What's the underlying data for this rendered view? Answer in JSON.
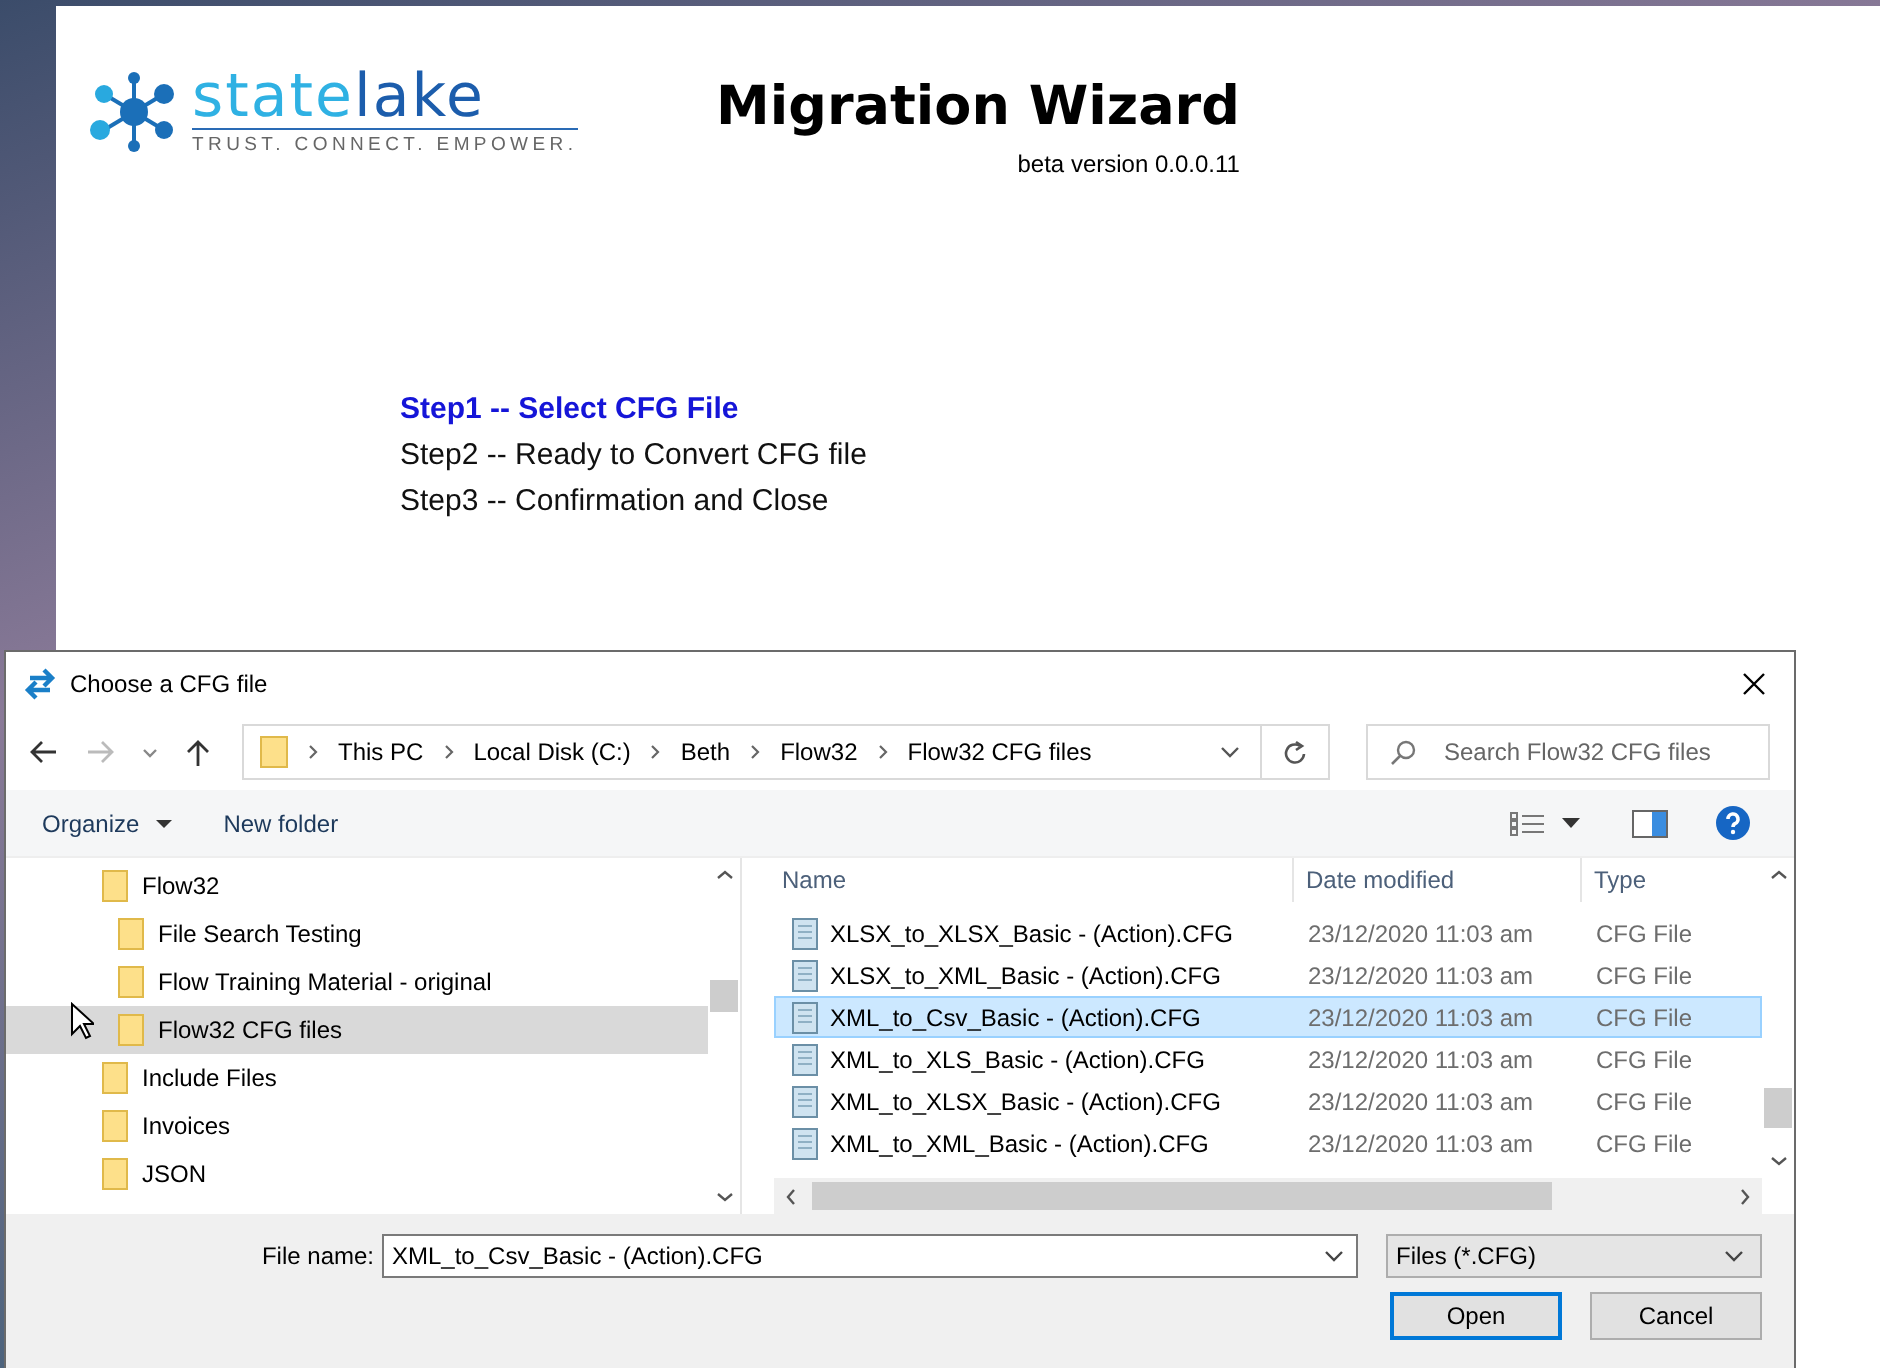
{
  "app": {
    "logo": {
      "part_1": "state",
      "part_2": "lake",
      "tagline": "TRUST. CONNECT. EMPOWER."
    },
    "title": "Migration Wizard",
    "version": "beta version 0.0.0.11",
    "steps": [
      {
        "label": "Step1 -- Select CFG File",
        "selected": true
      },
      {
        "label": "Step2 -- Ready to Convert CFG file",
        "selected": false
      },
      {
        "label": "Step3 -- Confirmation and Close",
        "selected": false
      }
    ]
  },
  "dialog": {
    "title": "Choose a CFG file",
    "breadcrumbs": [
      "This PC",
      "Local Disk (C:)",
      "Beth",
      "Flow32",
      "Flow32 CFG files"
    ],
    "search": {
      "placeholder": "Search Flow32 CFG files"
    },
    "toolbar": {
      "organize": "Organize",
      "new_folder": "New folder"
    },
    "tree": [
      {
        "label": "Flow32",
        "selected": false,
        "children": [
          {
            "label": "File Search Testing",
            "selected": false
          },
          {
            "label": "Flow Training Material - original",
            "selected": false
          },
          {
            "label": "Flow32 CFG files",
            "selected": true
          }
        ]
      },
      {
        "label": "Include Files",
        "selected": false
      },
      {
        "label": "Invoices",
        "selected": false
      },
      {
        "label": "JSON",
        "selected": false
      }
    ],
    "columns": [
      "Name",
      "Date modified",
      "Type"
    ],
    "rows": [
      {
        "name": "XLSX_to_XLSX_Basic - (Action).CFG",
        "date": "23/12/2020 11:03 am",
        "type": "CFG File",
        "selected": false
      },
      {
        "name": "XLSX_to_XML_Basic - (Action).CFG",
        "date": "23/12/2020 11:03 am",
        "type": "CFG File",
        "selected": false
      },
      {
        "name": "XML_to_Csv_Basic - (Action).CFG",
        "date": "23/12/2020 11:03 am",
        "type": "CFG File",
        "selected": true
      },
      {
        "name": "XML_to_XLS_Basic - (Action).CFG",
        "date": "23/12/2020 11:03 am",
        "type": "CFG File",
        "selected": false
      },
      {
        "name": "XML_to_XLSX_Basic - (Action).CFG",
        "date": "23/12/2020 11:03 am",
        "type": "CFG File",
        "selected": false
      },
      {
        "name": "XML_to_XML_Basic - (Action).CFG",
        "date": "23/12/2020 11:03 am",
        "type": "CFG File",
        "selected": false
      }
    ],
    "file_name_label": "File name:",
    "file_name": "XML_to_Csv_Basic - (Action).CFG",
    "filter": "Files (*.CFG)",
    "buttons": [
      "Open",
      "Cancel"
    ]
  }
}
